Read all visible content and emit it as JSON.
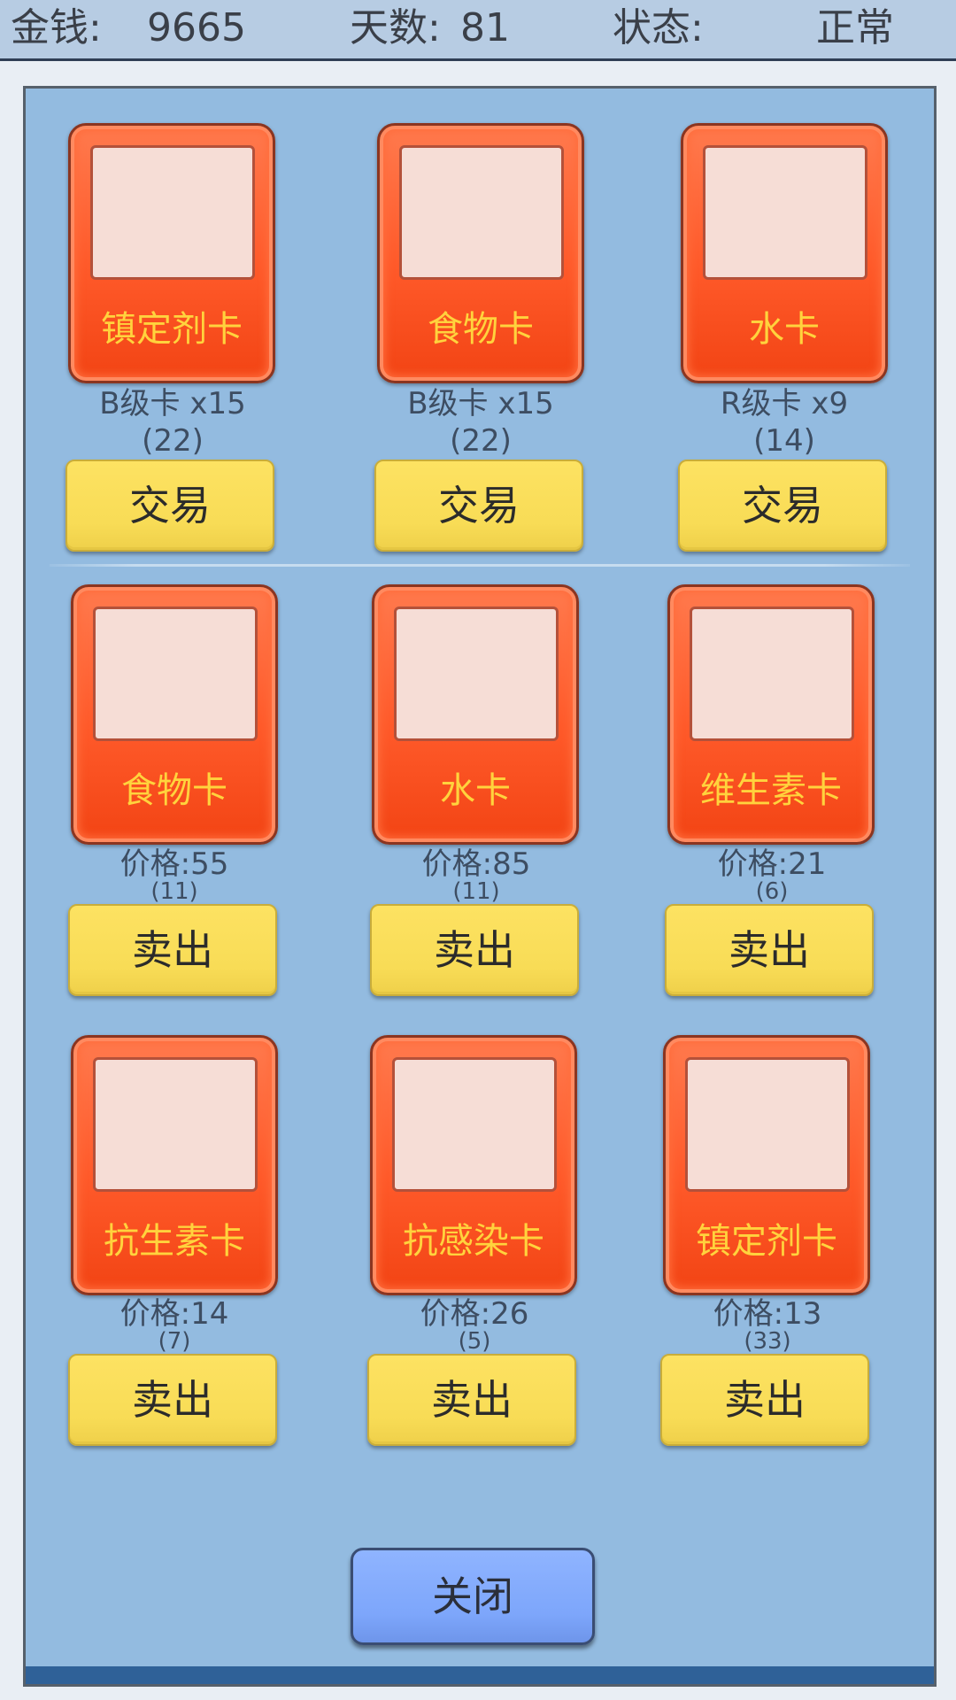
{
  "status_bar": {
    "money_label": "金钱:",
    "money_value": "9665",
    "days_label": "天数:",
    "days_value": "81",
    "status_label": "状态:",
    "status_value": "正常"
  },
  "trade_cards": [
    {
      "name": "镇定剂卡",
      "line1": "B级卡 x15",
      "line2": "(22)",
      "button": "交易"
    },
    {
      "name": "食物卡",
      "line1": "B级卡 x15",
      "line2": "(22)",
      "button": "交易"
    },
    {
      "name": "水卡",
      "line1": "R级卡 x9",
      "line2": "(14)",
      "button": "交易"
    }
  ],
  "sell_cards": [
    {
      "name": "食物卡",
      "price": "价格:55",
      "count": "(11)",
      "button": "卖出"
    },
    {
      "name": "水卡",
      "price": "价格:85",
      "count": "(11)",
      "button": "卖出"
    },
    {
      "name": "维生素卡",
      "price": "价格:21",
      "count": "(6)",
      "button": "卖出"
    },
    {
      "name": "抗生素卡",
      "price": "价格:14",
      "count": "(7)",
      "button": "卖出"
    },
    {
      "name": "抗感染卡",
      "price": "价格:26",
      "count": "(5)",
      "button": "卖出"
    },
    {
      "name": "镇定剂卡",
      "price": "价格:13",
      "count": "(33)",
      "button": "卖出"
    }
  ],
  "close_button": "关闭",
  "colors": {
    "card": "#ff5a2a",
    "card_name": "#ffd33d",
    "button": "#fde262",
    "close_button": "#7da6fb",
    "panel": "#93bbe0"
  }
}
